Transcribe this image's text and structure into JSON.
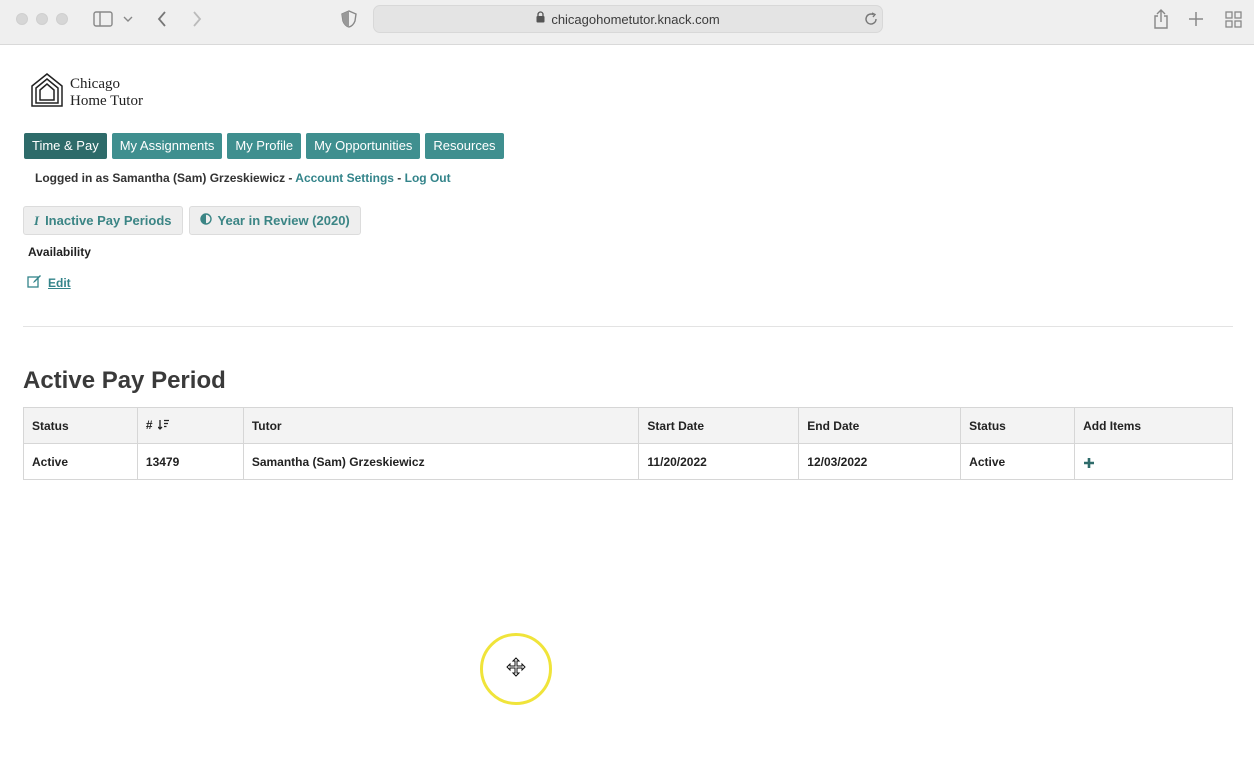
{
  "browser": {
    "url": "chicagohometutor.knack.com"
  },
  "logo": {
    "line1": "Chicago",
    "line2": "Home Tutor"
  },
  "nav": {
    "items": [
      {
        "label": "Time & Pay",
        "active": true
      },
      {
        "label": "My Assignments",
        "active": false
      },
      {
        "label": "My Profile",
        "active": false
      },
      {
        "label": "My Opportunities",
        "active": false
      },
      {
        "label": "Resources",
        "active": false
      }
    ]
  },
  "session": {
    "prefix": "Logged in as Samantha (Sam) Grzeskiewicz - ",
    "account_settings": "Account Settings",
    "separator": " - ",
    "logout": "Log Out"
  },
  "actions": {
    "inactive_pay_periods": "Inactive Pay Periods",
    "year_in_review": "Year in Review (2020)"
  },
  "availability": {
    "label": "Availability",
    "edit": "Edit"
  },
  "pay_period": {
    "title": "Active Pay Period",
    "headers": [
      "Status",
      "#",
      "Tutor",
      "Start Date",
      "End Date",
      "Status",
      "Add Items"
    ],
    "rows": [
      {
        "status": "Active",
        "number": "13479",
        "tutor": "Samantha (Sam) Grzeskiewicz",
        "start_date": "11/20/2022",
        "end_date": "12/03/2022",
        "status2": "Active"
      }
    ]
  },
  "colors": {
    "nav_bg": "#3f8f8f",
    "nav_active_bg": "#2e6b6a",
    "link": "#33848a",
    "cursor_ring": "#f0e43a"
  }
}
